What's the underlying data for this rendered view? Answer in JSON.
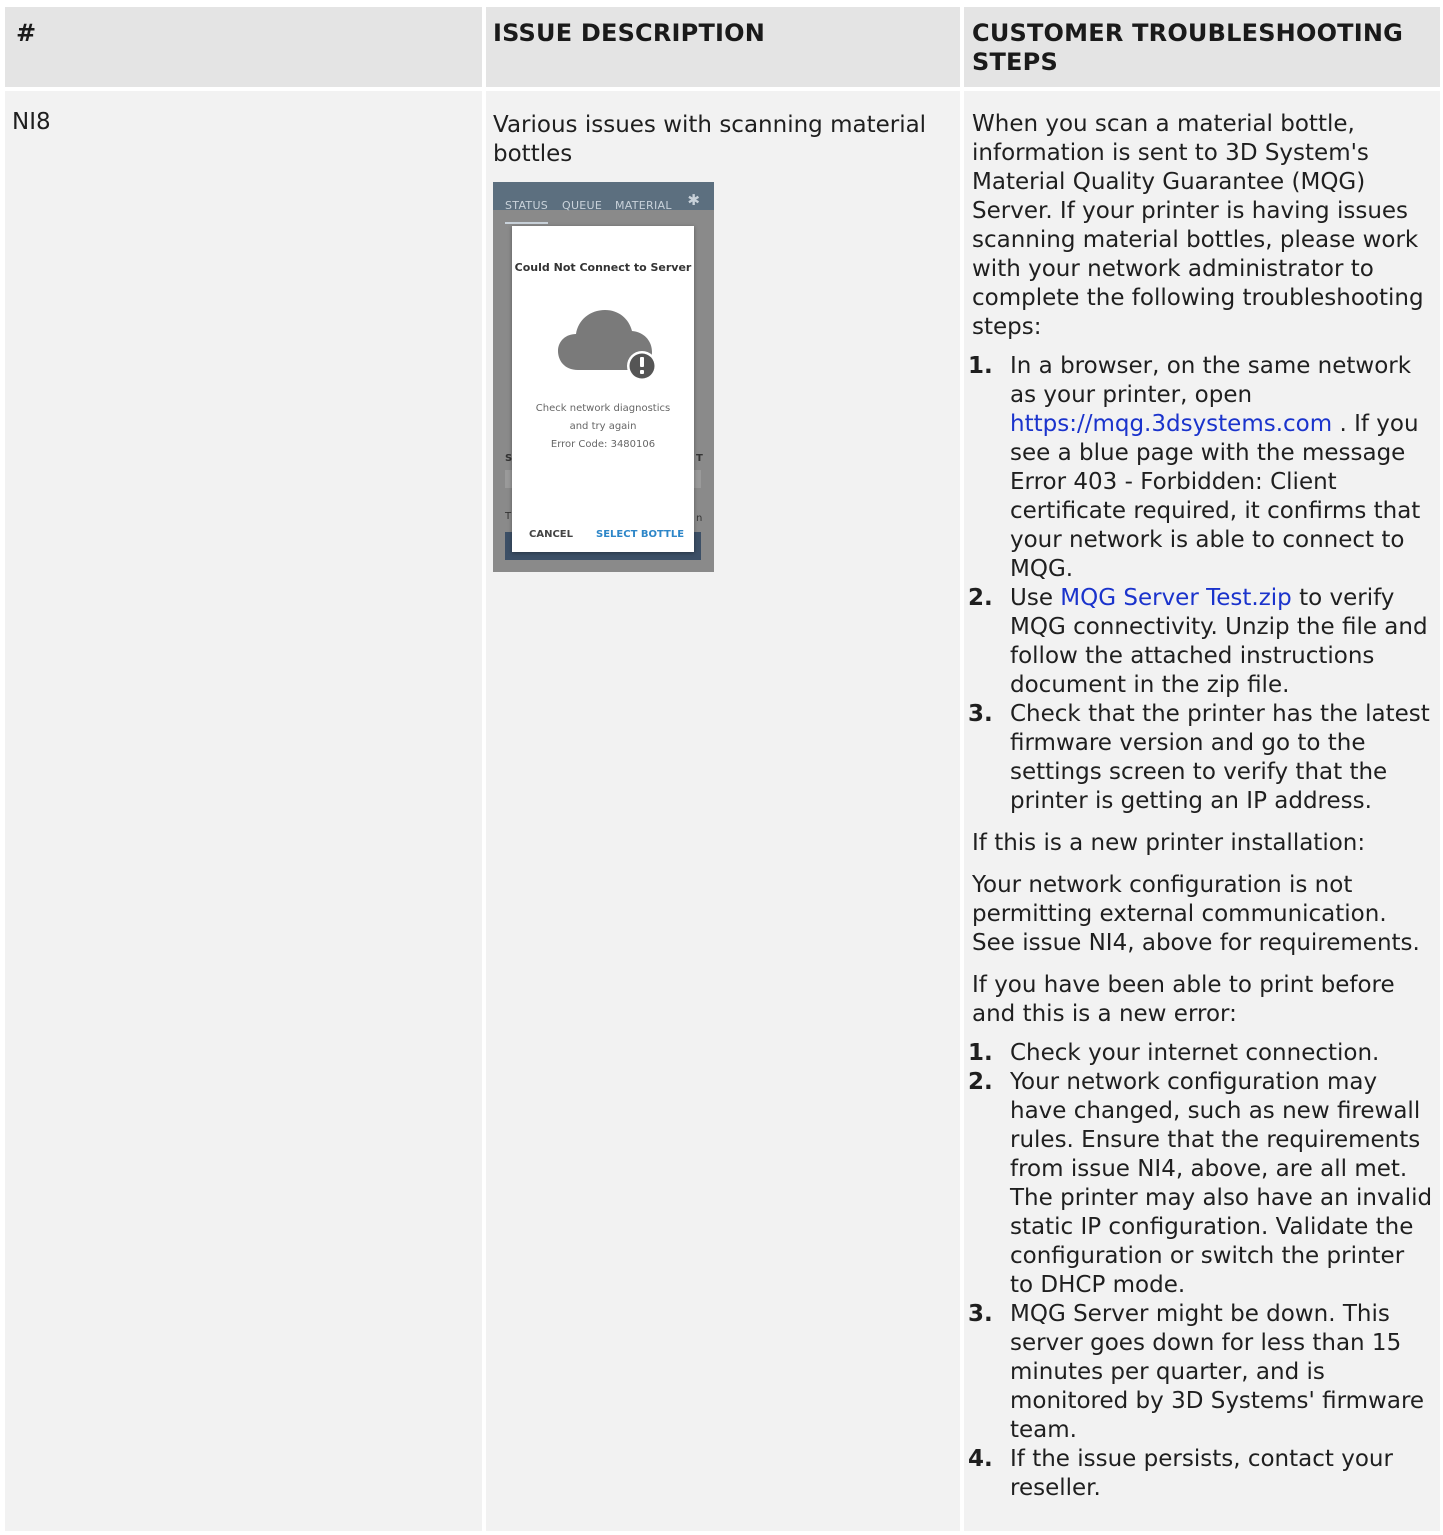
{
  "headers": {
    "number": "#",
    "issue": "ISSUE DESCRIPTION",
    "steps": "CUSTOMER TROUBLESHOOTING STEPS"
  },
  "row": {
    "id": "NI8",
    "issue_text": "Various issues with scanning material bottles",
    "screenshot": {
      "tabs": [
        "STATUS",
        "QUEUE",
        "MATERIAL"
      ],
      "dialog_title": "Could Not Connect to Server",
      "message_line1": "Check network diagnostics",
      "message_line2": "and try again",
      "error_code": "Error Code: 3480106",
      "cancel_label": "CANCEL",
      "select_label": "SELECT BOTTLE",
      "colors": {
        "topbar": "#5c6f7f",
        "accent": "#2d86c8",
        "cloud": "#7a7a7a"
      }
    },
    "intro": "When you scan a material bottle, information is sent to 3D System's Material Quality Guarantee (MQG) Server. If your printer is having issues scanning material bottles, please work with your network administrator to complete the following troubleshooting steps:",
    "steps": [
      {
        "num": "1.",
        "pre": "In a browser, on the same network as your printer, open ",
        "link": "https://mqg.3dsystems.com",
        "post": " . If you see a blue page with the message Error 403 - Forbidden: Client certificate required, it confirms that your network is able to connect to MQG."
      },
      {
        "num": "2.",
        "pre": "Use ",
        "link": "MQG Server Test.zip",
        "post": " to verify MQG connectivity. Unzip the file and follow the attached instructions document in the zip file."
      },
      {
        "num": "3.",
        "pre": "Check that the printer has the latest firmware version and go to the settings screen to verify that the printer is getting an IP address.",
        "link": "",
        "post": ""
      }
    ],
    "new_install_heading": "If this is a new printer installation:",
    "new_install_text": "Your network configuration is not permitting external communication. See issue NI4, above for requirements.",
    "new_error_heading": "If you have been able to print before and this is a new error:",
    "new_error_steps": [
      {
        "num": "1.",
        "text": "Check your internet connection."
      },
      {
        "num": "2.",
        "text": "Your network configuration may have changed, such as new firewall rules. Ensure that the requirements from issue NI4, above, are all met. The printer may also have an invalid static IP configuration. Validate the configuration or switch the printer to DHCP mode."
      },
      {
        "num": "3.",
        "text": "MQG Server might be down. This server goes down for less than 15 minutes per quarter, and is monitored by 3D Systems' firmware team."
      },
      {
        "num": "4.",
        "text": "If the issue persists, contact your reseller."
      }
    ]
  }
}
